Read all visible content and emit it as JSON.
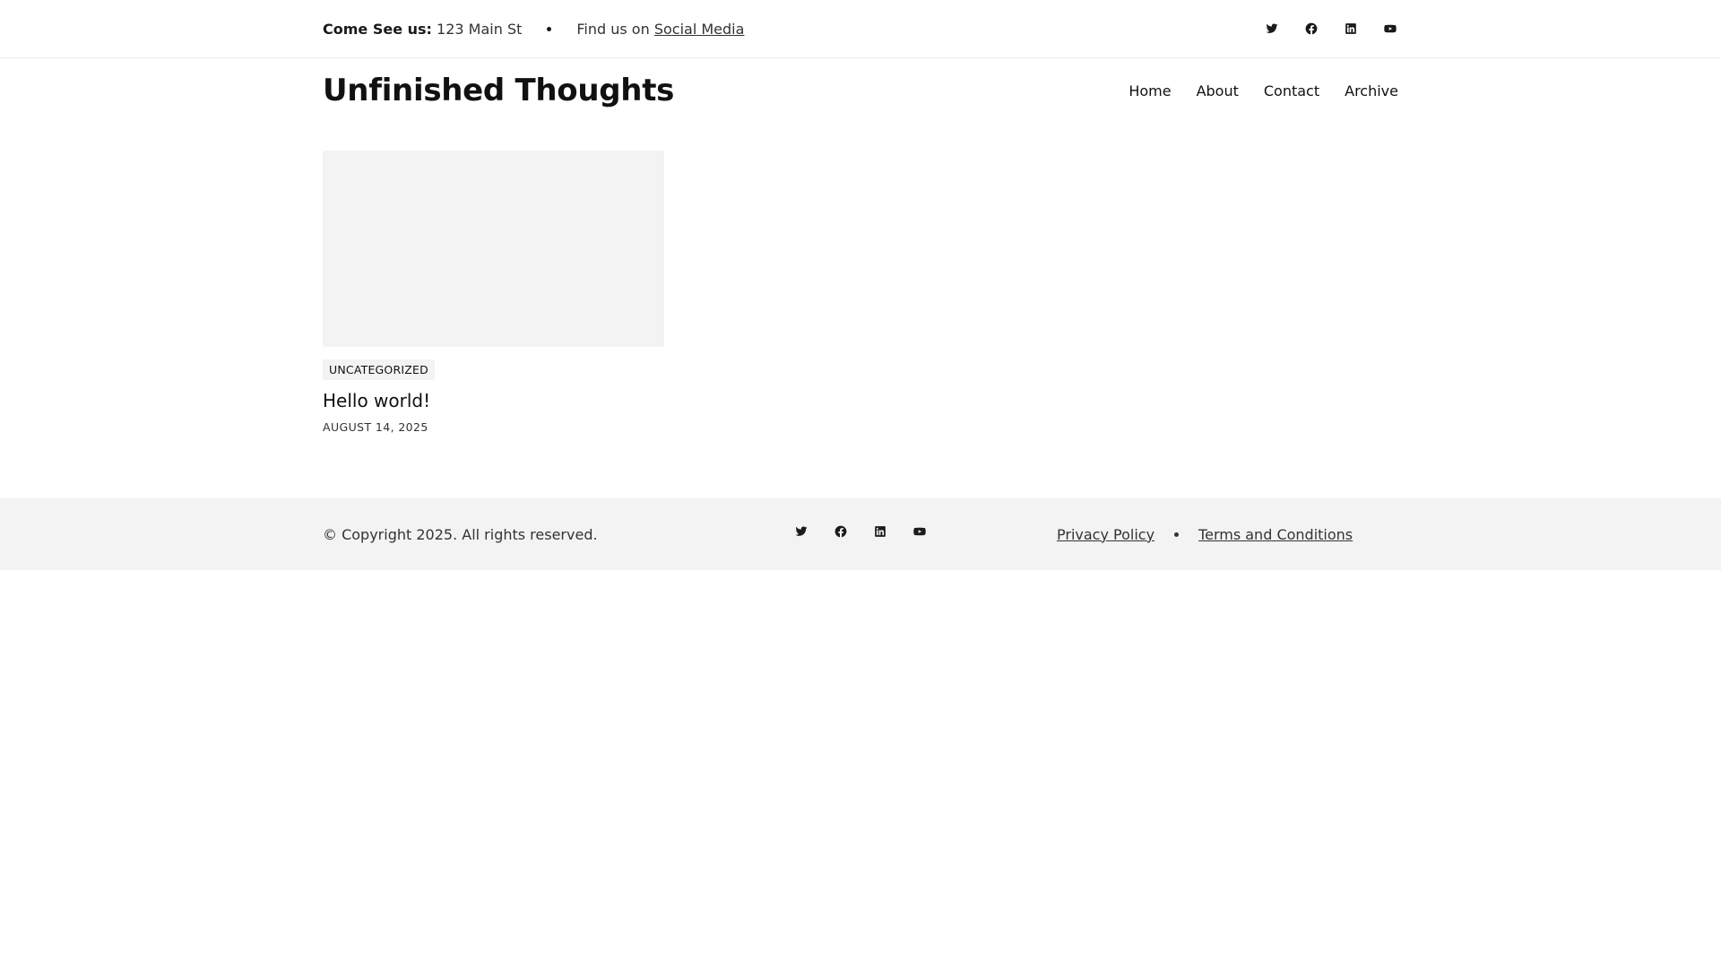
{
  "topbar": {
    "visit_label": "Come See us:",
    "address": "123 Main St",
    "find_text": "Find us on",
    "social_link": "Social Media",
    "social_icons": [
      "twitter-icon",
      "facebook-icon",
      "linkedin-icon",
      "youtube-icon"
    ]
  },
  "header": {
    "site_title": "Unfinished Thoughts",
    "nav": [
      {
        "label": "Home"
      },
      {
        "label": "About"
      },
      {
        "label": "Contact"
      },
      {
        "label": "Archive"
      }
    ]
  },
  "post": {
    "category": "UNCATEGORIZED",
    "title": "Hello world!",
    "date": "AUGUST 14, 2025"
  },
  "footer": {
    "copyright": "© Copyright 2025. All rights reserved.",
    "social_icons": [
      "twitter-icon",
      "facebook-icon",
      "linkedin-icon",
      "youtube-icon"
    ],
    "links": [
      {
        "label": "Privacy Policy"
      },
      {
        "label": "Terms and Conditions"
      }
    ]
  },
  "colors": {
    "text": "#1a1a1a",
    "muted_bg": "#f3f3f3",
    "border": "#ececec"
  }
}
